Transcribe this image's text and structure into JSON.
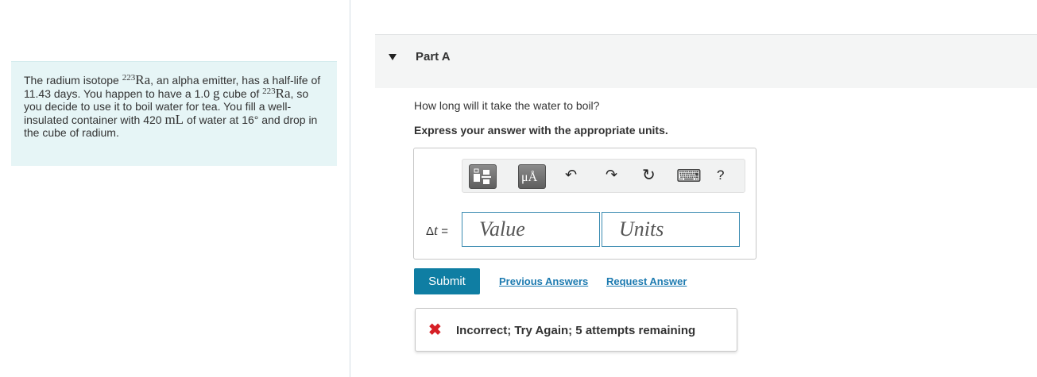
{
  "problem": {
    "s1": "The radium isotope ",
    "isotope_mass": "223",
    "isotope_symbol": "Ra",
    "s2": ", an alpha emitter, has a half-life of 11.43 days. You happen to have a 1.0 ",
    "unit_g": "g",
    "s3": " cube of ",
    "s4": ", so you decide to use it to boil water for tea. You fill a well-insulated container with 420 ",
    "unit_ml": "mL",
    "s5": " of water at 16",
    "degree": "°",
    "s6": " and drop in the cube of radium."
  },
  "part": {
    "title": "Part A"
  },
  "question": "How long will it take the water to boil?",
  "instruction": "Express your answer with the appropriate units.",
  "toolbar": {
    "templates_icon": "templates-icon",
    "units_button": "μÅ",
    "undo_icon": "↶",
    "redo_icon": "↷",
    "reset_icon": "↻",
    "keyboard_icon": "⌨",
    "help_icon": "?"
  },
  "answer": {
    "label_symbol": "Δ",
    "label_var": "t",
    "label_eq": " =",
    "value_placeholder": "Value",
    "units_placeholder": "Units"
  },
  "actions": {
    "submit": "Submit",
    "previous_answers": "Previous Answers",
    "request_answer": "Request Answer"
  },
  "feedback": {
    "icon": "✖",
    "text": "Incorrect; Try Again; 5 attempts remaining"
  },
  "colors": {
    "accent": "#0f7ea3",
    "link": "#1c7ab0",
    "error": "#d61f26",
    "panel": "#e6f5f6"
  }
}
